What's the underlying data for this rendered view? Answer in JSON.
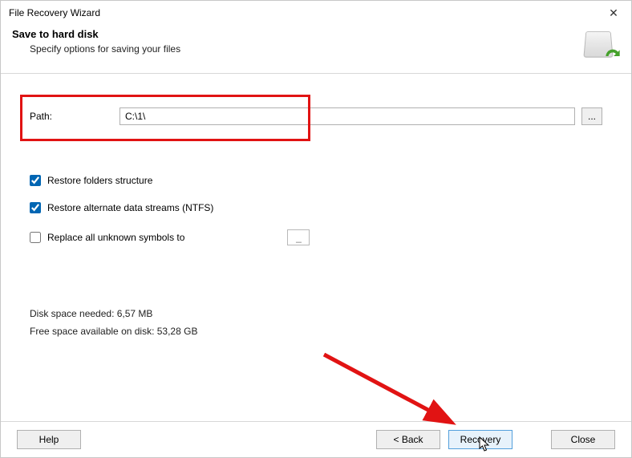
{
  "window": {
    "title": "File Recovery Wizard",
    "close_symbol": "✕"
  },
  "header": {
    "heading": "Save to hard disk",
    "subtext": "Specify options for saving your files"
  },
  "path": {
    "label": "Path:",
    "value": "C:\\1\\",
    "browse_label": "..."
  },
  "options": {
    "restore_folders": {
      "label": "Restore folders structure",
      "checked": true
    },
    "restore_ads": {
      "label": "Restore alternate data streams (NTFS)",
      "checked": true
    },
    "replace_unknown": {
      "label": "Replace all unknown symbols to",
      "checked": false,
      "value": "_"
    }
  },
  "disk": {
    "needed": "Disk space needed: 6,57 MB",
    "free": "Free space available on disk: 53,28 GB"
  },
  "footer": {
    "help": "Help",
    "back": "< Back",
    "recovery": "Recovery",
    "close": "Close"
  }
}
